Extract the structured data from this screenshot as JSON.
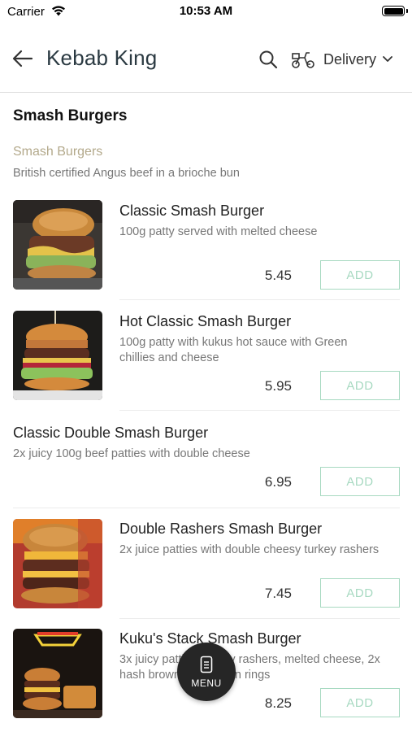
{
  "status_bar": {
    "carrier": "Carrier",
    "time": "10:53 AM"
  },
  "header": {
    "title": "Kebab King",
    "delivery_mode": "Delivery",
    "icons": [
      "back-arrow-icon",
      "search-icon",
      "scooter-icon",
      "chevron-down-icon"
    ]
  },
  "section": {
    "title": "Smash Burgers",
    "category_name": "Smash Burgers",
    "category_description": "British certified Angus beef in a brioche bun"
  },
  "items": [
    {
      "name": "Classic Smash Burger",
      "description_lines": [
        "100g patty served with melted cheese"
      ],
      "price": "5.45",
      "add_label": "ADD",
      "image": "classic-smash-burger-photo"
    },
    {
      "name": "Hot Classic Smash Burger",
      "description_lines": [
        "100g patty with kukus hot sauce with Green",
        "chillies and cheese"
      ],
      "price": "5.95",
      "add_label": "ADD",
      "image": "hot-classic-smash-burger-photo"
    },
    {
      "name": "Classic Double Smash Burger",
      "description_lines": [
        "2x juicy 100g beef patties with double cheese"
      ],
      "price": "6.95",
      "add_label": "ADD"
    },
    {
      "name": "Double Rashers Smash Burger",
      "description_lines": [
        "2x juice patties with double cheesy turkey rashers"
      ],
      "price": "7.45",
      "add_label": "ADD",
      "image": "double-rashers-smash-burger-photo"
    },
    {
      "name": "Kuku's Stack Smash Burger",
      "description_lines": [
        "3x juicy patties, turkey rashers, melted cheese, 2x",
        "hash browns and onion rings"
      ],
      "price": "8.25",
      "add_label": "ADD",
      "image": "kukus-stack-smash-burger-photo"
    }
  ],
  "menu_button": {
    "label": "MENU"
  },
  "colors": {
    "accent_add": "#a7d9c1",
    "category_name": "#b3a98b",
    "title": "#2b3a42",
    "fab": "#262626"
  }
}
